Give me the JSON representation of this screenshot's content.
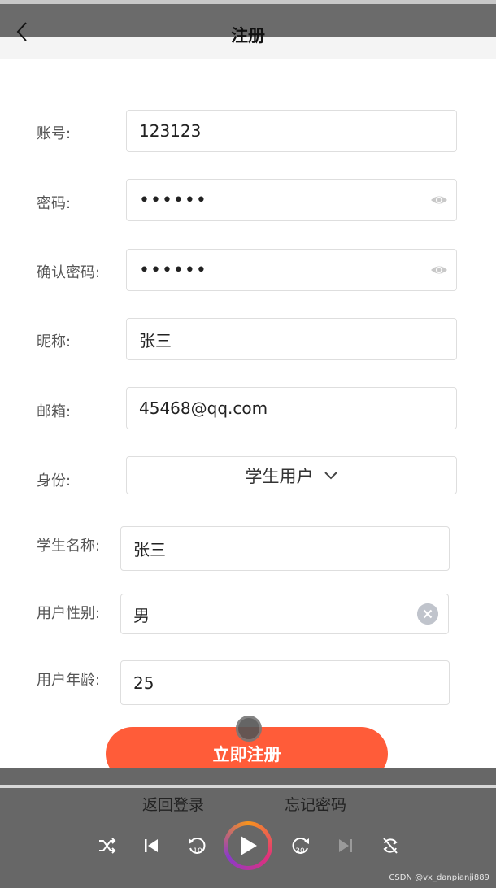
{
  "header": {
    "title": "注册"
  },
  "form": {
    "account": {
      "label": "账号:",
      "value": "123123"
    },
    "password": {
      "label": "密码:",
      "value": "123456"
    },
    "confirm_password": {
      "label": "确认密码:",
      "value": "123456"
    },
    "nickname": {
      "label": "昵称:",
      "value": "张三"
    },
    "email": {
      "label": "邮箱:",
      "value": "45468@qq.com"
    },
    "role": {
      "label": "身份:",
      "value": "学生用户"
    },
    "student_name": {
      "label": "学生名称:",
      "value": "张三"
    },
    "gender": {
      "label": "用户性别:",
      "value": "男"
    },
    "age": {
      "label": "用户年龄:",
      "value": "25"
    }
  },
  "submit_label": "立即注册",
  "links": {
    "back_login": "返回登录",
    "forgot_password": "忘记密码"
  },
  "player": {
    "rewind_seconds": "10",
    "forward_seconds": "30"
  },
  "watermark": "CSDN @vx_danpianji889",
  "colors": {
    "accent": "#ff5c39",
    "overlay": "#676767"
  }
}
